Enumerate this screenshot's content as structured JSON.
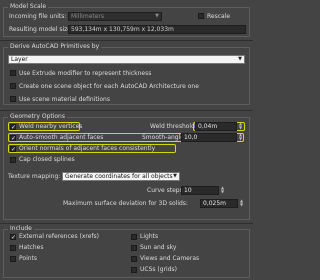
{
  "model_scale": {
    "title": "Model Scale",
    "incoming_units_label": "Incoming file units:",
    "incoming_units_value": "Millimeters",
    "rescale_label": "Rescale",
    "rescale_checked": false,
    "resulting_size_label": "Resulting model size:",
    "resulting_size_value": "593,134m x 130,759m x 12,033m"
  },
  "derive": {
    "title": "Derive AutoCAD Primitives by",
    "mode_value": "Layer",
    "options": [
      {
        "label": "Use Extrude modifier to represent thickness",
        "checked": false
      },
      {
        "label": "Create one scene object for each AutoCAD Architecture one",
        "checked": false
      },
      {
        "label": "Use scene material definitions",
        "checked": false
      }
    ]
  },
  "geometry": {
    "title": "Geometry Options",
    "weld_label": "Weld nearby vertices",
    "weld_checked": true,
    "weld_threshold_label": "Weld threshold:",
    "weld_threshold_value": "0,04m",
    "autosmooth_label": "Auto-smooth adjacent faces",
    "autosmooth_checked": true,
    "smooth_angle_label": "Smooth-angle:",
    "smooth_angle_value": "10,0",
    "orient_label": "Orient normals of adjacent faces consistently",
    "orient_checked": true,
    "cap_label": "Cap closed splines",
    "cap_checked": false,
    "texture_label": "Texture mapping:",
    "texture_value": "Generate coordinates for all objects",
    "curve_steps_label": "Curve steps:",
    "curve_steps_value": "10",
    "max_dev_label": "Maximum surface deviation for 3D solids:",
    "max_dev_value": "0,025m",
    "highlight_color": "#d8d800"
  },
  "include": {
    "title": "Include",
    "left": [
      {
        "label": "External references (xrefs)",
        "checked": true
      },
      {
        "label": "Hatches",
        "checked": false
      },
      {
        "label": "Points",
        "checked": false
      }
    ],
    "right": [
      {
        "label": "Lights",
        "checked": false
      },
      {
        "label": "Sun and sky",
        "checked": false
      },
      {
        "label": "Views and Cameras",
        "checked": false
      },
      {
        "label": "UCSs (grids)",
        "checked": false
      }
    ]
  },
  "icons": {
    "dropdown": "chevron-down-icon",
    "check": "checkmark-icon",
    "spinner": "spinner-arrows-icon"
  }
}
